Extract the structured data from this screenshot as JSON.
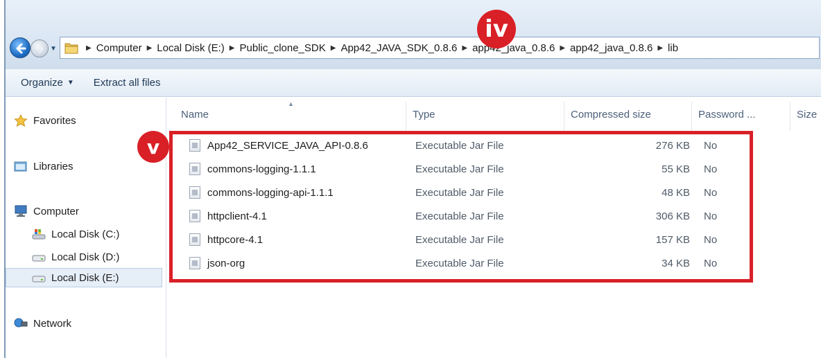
{
  "breadcrumbs": [
    "Computer",
    "Local Disk (E:)",
    "Public_clone_SDK",
    "App42_JAVA_SDK_0.8.6",
    "app42_java_0.8.6",
    "app42_java_0.8.6",
    "lib"
  ],
  "annotations": {
    "step_iv": "iv",
    "step_v": "v"
  },
  "toolbar": {
    "organize_label": "Organize",
    "extract_label": "Extract all files"
  },
  "sidebar": {
    "favorites": "Favorites",
    "libraries": "Libraries",
    "computer": "Computer",
    "drives": [
      "Local Disk (C:)",
      "Local Disk (D:)",
      "Local Disk (E:)"
    ],
    "network": "Network"
  },
  "columns": {
    "name": "Name",
    "type": "Type",
    "compressed": "Compressed size",
    "password": "Password ...",
    "size": "Size"
  },
  "files": [
    {
      "name": "App42_SERVICE_JAVA_API-0.8.6",
      "type": "Executable Jar File",
      "compressed": "276 KB",
      "password": "No"
    },
    {
      "name": "commons-logging-1.1.1",
      "type": "Executable Jar File",
      "compressed": "55 KB",
      "password": "No"
    },
    {
      "name": "commons-logging-api-1.1.1",
      "type": "Executable Jar File",
      "compressed": "48 KB",
      "password": "No"
    },
    {
      "name": "httpclient-4.1",
      "type": "Executable Jar File",
      "compressed": "306 KB",
      "password": "No"
    },
    {
      "name": "httpcore-4.1",
      "type": "Executable Jar File",
      "compressed": "157 KB",
      "password": "No"
    },
    {
      "name": "json-org",
      "type": "Executable Jar File",
      "compressed": "34 KB",
      "password": "No"
    }
  ],
  "colors": {
    "annotation_red": "#d92027",
    "selection_bg": "#e6eef8"
  }
}
